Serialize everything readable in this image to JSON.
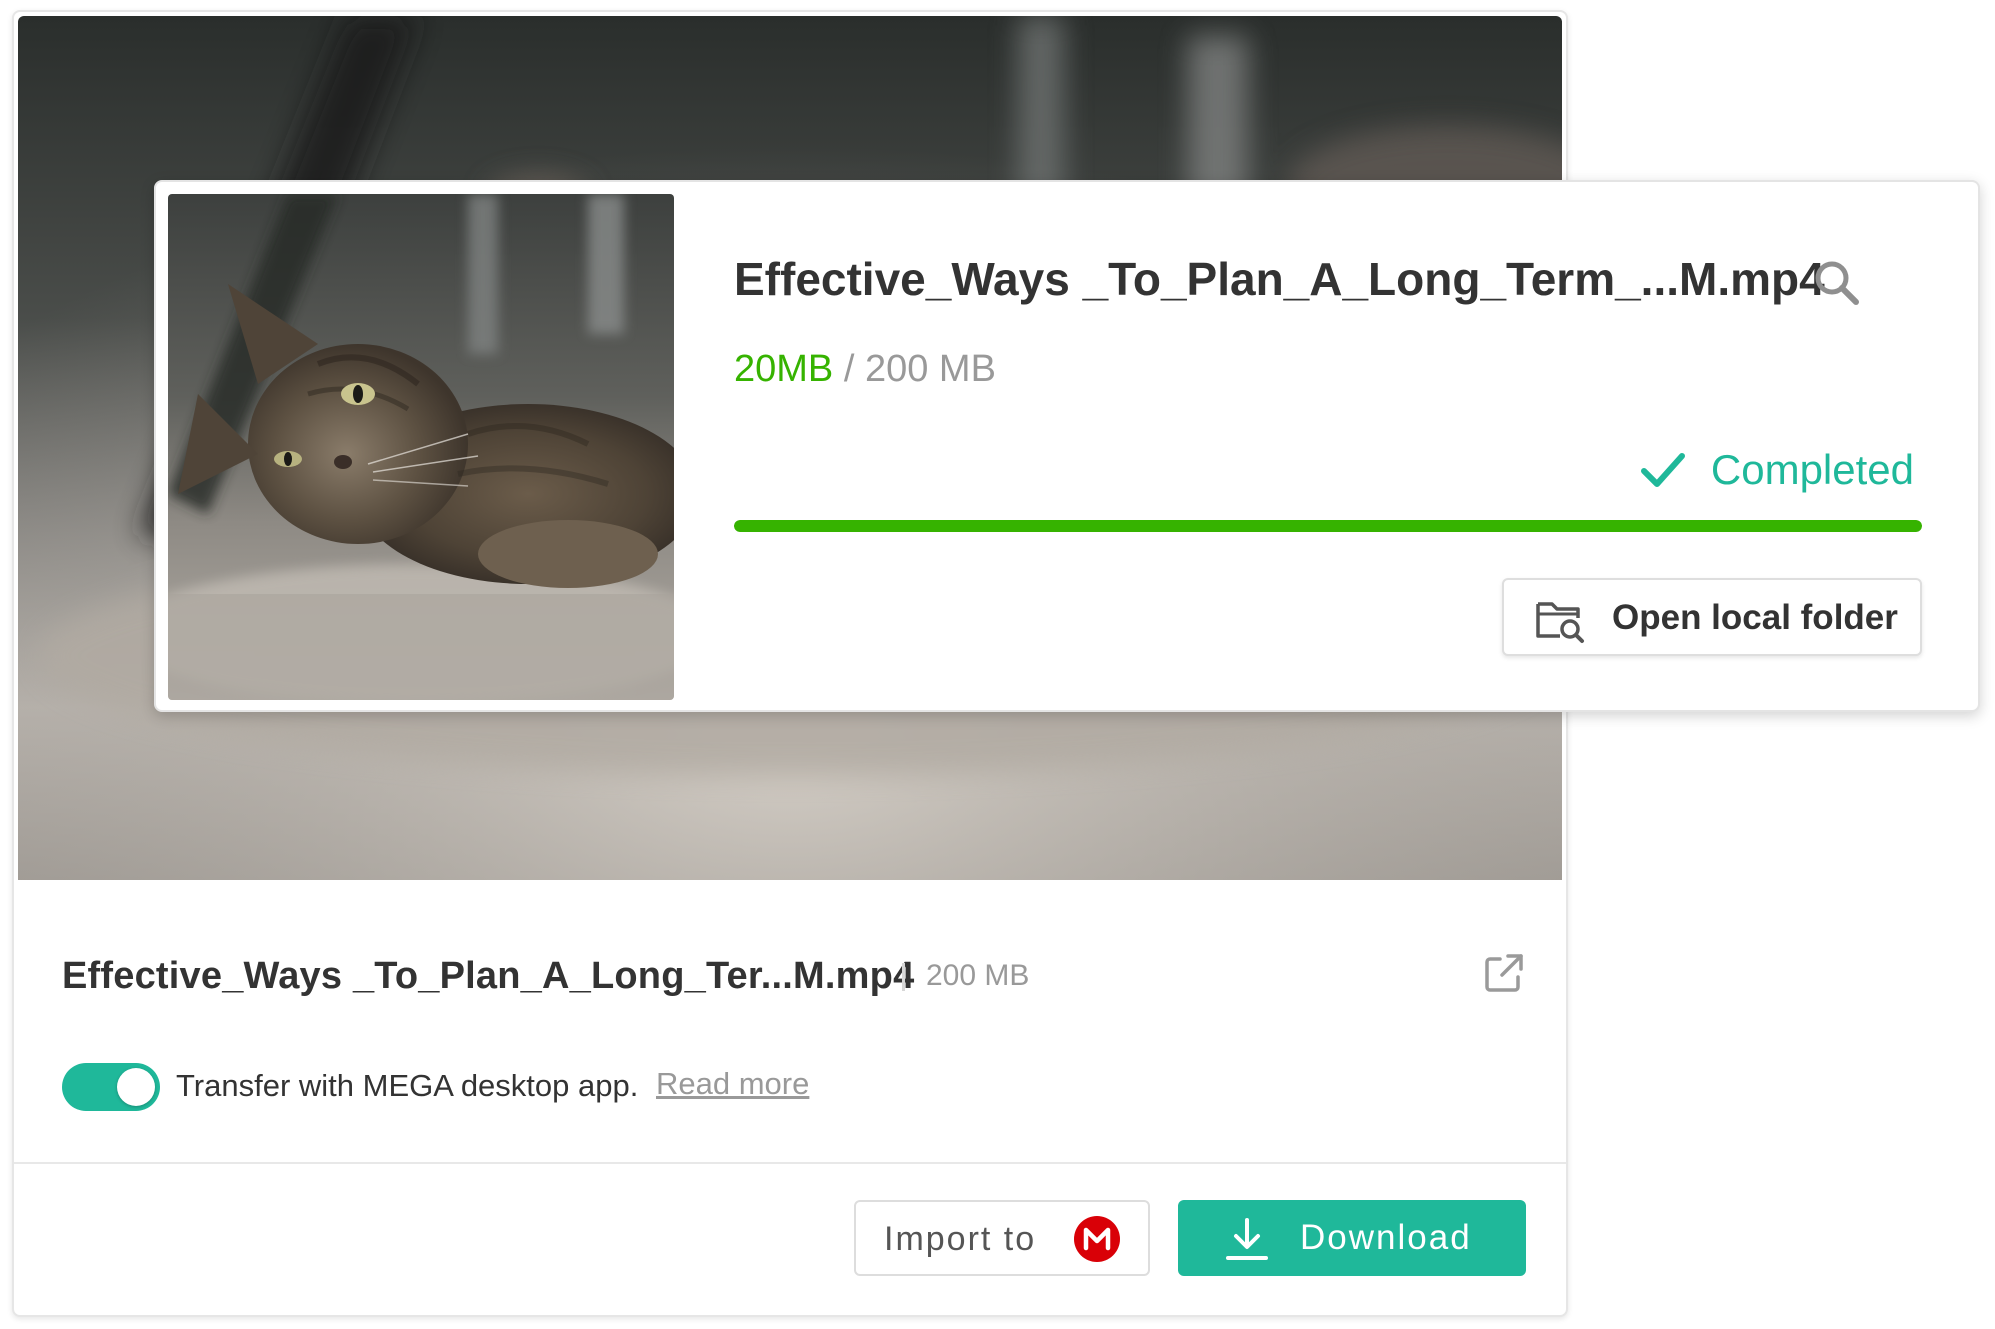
{
  "file_card": {
    "file_name": "Effective_Ways _To_Plan_A_Long_Ter...M.mp4",
    "file_size": "200 MB",
    "transfer_toggle_on": true,
    "transfer_text": "Transfer with MEGA desktop app.",
    "read_more_label": "Read more",
    "import_label": "Import to",
    "download_label": "Download"
  },
  "popup": {
    "title": "Effective_Ways _To_Plan_A_Long_Term_...M.mp4",
    "size_done": "20MB",
    "size_separator": " / ",
    "size_total": "200 MB",
    "status": "Completed",
    "progress_fraction": 1.0,
    "open_folder_label": "Open local folder"
  },
  "icons": {
    "popup_search": "search-icon",
    "status": "checkmark-icon",
    "open_folder": "folder-search-icon",
    "external": "external-link-icon",
    "mega": "mega-logo-icon",
    "download": "download-icon"
  },
  "colors": {
    "accent_teal": "#1fb89a",
    "progress_green": "#36b300",
    "mega_red": "#d90007",
    "text_dark": "#333333",
    "text_muted": "#999999"
  }
}
